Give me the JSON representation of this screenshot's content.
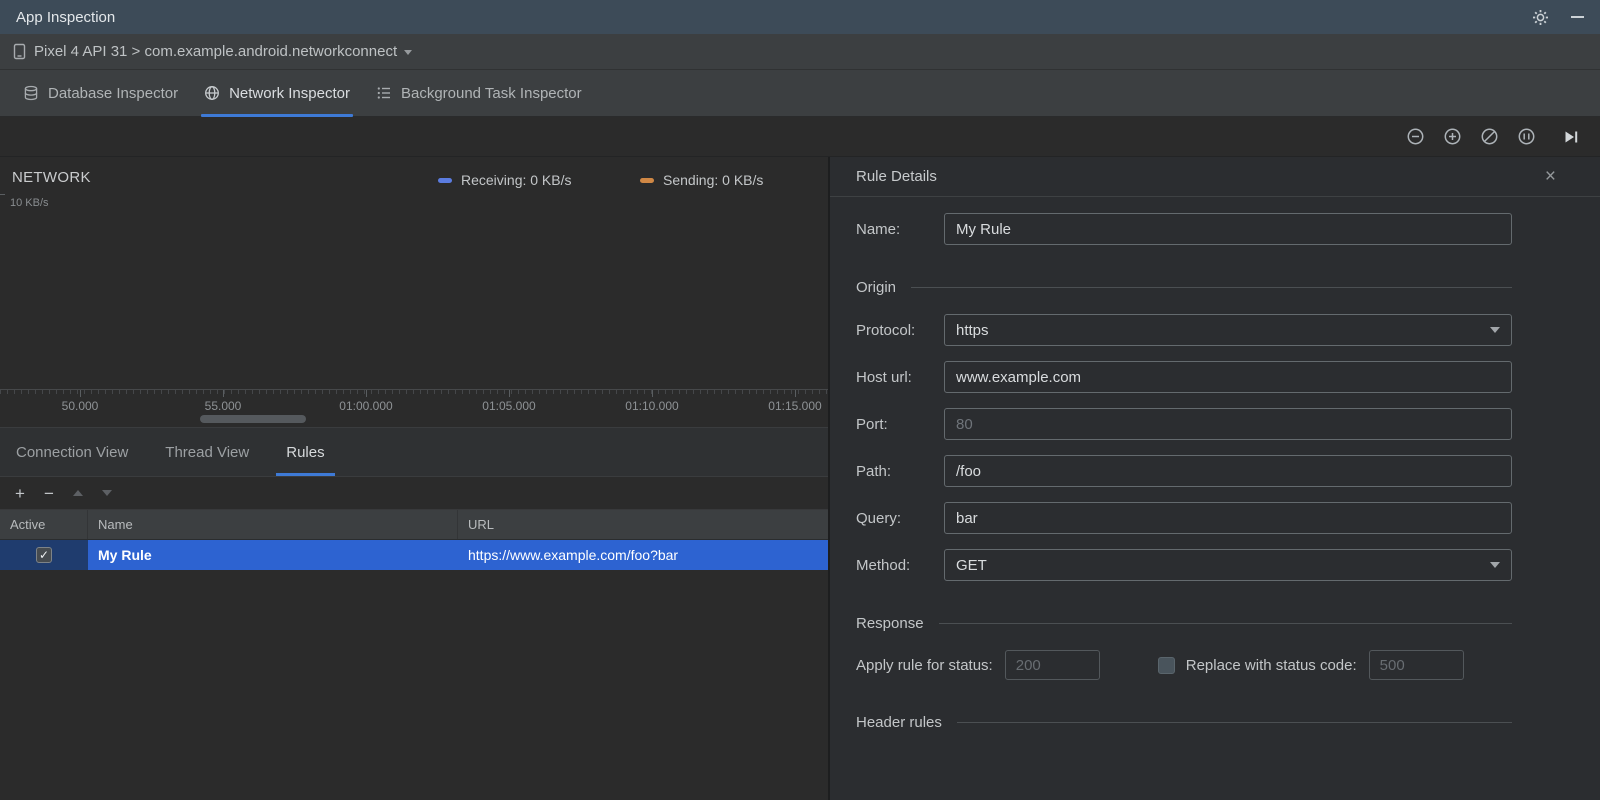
{
  "colors": {
    "accent_blue": "#3e7ad6",
    "selection_blue": "#2d63d1",
    "receiving_swatch": "#5b7ce0",
    "sending_swatch": "#d08845"
  },
  "title_bar": {
    "title": "App Inspection"
  },
  "device_bar": {
    "selector": "Pixel 4 API 31 > com.example.android.networkconnect"
  },
  "inspector_tabs": [
    {
      "label": "Database Inspector"
    },
    {
      "label": "Network Inspector"
    },
    {
      "label": "Background Task Inspector"
    }
  ],
  "timeline": {
    "section_label": "NETWORK",
    "y_max_label": "10 KB/s",
    "legend": [
      {
        "label": "Receiving: 0 KB/s"
      },
      {
        "label": "Sending: 0 KB/s"
      }
    ],
    "ticks": [
      "50.000",
      "55.000",
      "01:00.000",
      "01:05.000",
      "01:10.000",
      "01:15.000"
    ]
  },
  "view_tabs": [
    {
      "label": "Connection View"
    },
    {
      "label": "Thread View"
    },
    {
      "label": "Rules"
    }
  ],
  "rules_table": {
    "columns": [
      "Active",
      "Name",
      "URL"
    ],
    "rows": [
      {
        "active": "✓",
        "name": "My Rule",
        "url": "https://www.example.com/foo?bar"
      }
    ]
  },
  "rule_details": {
    "title": "Rule Details",
    "sections": {
      "origin": "Origin",
      "response": "Response",
      "header_rules": "Header rules"
    },
    "fields": {
      "name": {
        "label": "Name:",
        "value": "My Rule"
      },
      "protocol": {
        "label": "Protocol:",
        "value": "https"
      },
      "host": {
        "label": "Host url:",
        "value": "www.example.com"
      },
      "port": {
        "label": "Port:",
        "placeholder": "80"
      },
      "path": {
        "label": "Path:",
        "value": "/foo"
      },
      "query": {
        "label": "Query:",
        "value": "bar"
      },
      "method": {
        "label": "Method:",
        "value": "GET"
      }
    },
    "response": {
      "apply_label": "Apply rule for status:",
      "apply_placeholder": "200",
      "replace_label": "Replace with status code:",
      "replace_placeholder": "500"
    }
  },
  "glyphs": {
    "check": "✓",
    "close": "×",
    "add": "+",
    "remove": "−"
  }
}
